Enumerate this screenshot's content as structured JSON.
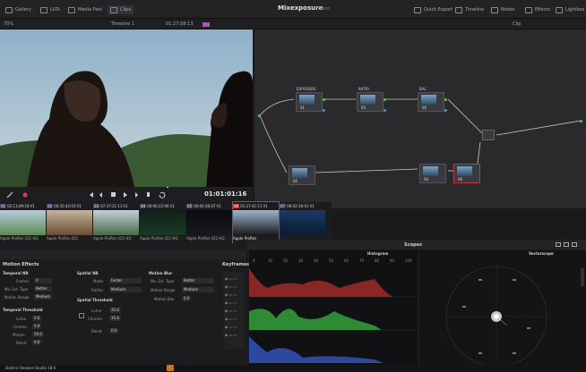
{
  "topbar": {
    "items": [
      "Gallery",
      "LUTs",
      "Media Pool",
      "Clips"
    ],
    "title": "Mixexposure",
    "status": "Edited",
    "right_items": [
      "Quick Export",
      "Timeline",
      "Nodes",
      "Effects",
      "Lightbox"
    ]
  },
  "subbar": {
    "zoom": "70%",
    "timeline": "Timeline 1",
    "timecode": "01:27:58:13",
    "mode": "Clip"
  },
  "viewer": {
    "timecode": "01:01:01:16"
  },
  "nodes": [
    {
      "label": "EXPOSURE",
      "num": "01"
    },
    {
      "label": "RATIO",
      "num": "03"
    },
    {
      "label": "BAL",
      "num": "05"
    },
    {
      "label": "",
      "num": "02"
    },
    {
      "label": "",
      "num": "04"
    },
    {
      "label": "",
      "num": "06"
    }
  ],
  "clips": [
    {
      "num": "01",
      "tc": "02:13:49:18",
      "track": "V1",
      "codec": "Apple ProRes 422 HQ"
    },
    {
      "num": "02",
      "tc": "00:35:42:03",
      "track": "V1",
      "codec": "Apple ProRes 422"
    },
    {
      "num": "03",
      "tc": "07:37:21:13",
      "track": "V1",
      "codec": "Apple ProRes 422 HQ"
    },
    {
      "num": "04",
      "tc": "00:00:22:06",
      "track": "V1",
      "codec": "Apple ProRes 422 HQ"
    },
    {
      "num": "05",
      "tc": "00:00:36:07",
      "track": "V1",
      "codec": "Apple ProRes 422 HQ"
    },
    {
      "num": "06",
      "tc": "01:27:41:11",
      "track": "V1",
      "codec": "Apple ProRes"
    },
    {
      "num": "07",
      "tc": "06:02:16:01",
      "track": "V1",
      "codec": ""
    }
  ],
  "motion_effects": {
    "title": "Motion Effects",
    "temporal_nr": "Temporal NR",
    "frames_label": "Frames",
    "frames_value": "0",
    "mo_est_label": "Mo. Est. Type",
    "mo_est_value": "Better",
    "motion_range_label": "Motion Range",
    "motion_range_value": "Medium",
    "temporal_threshold": "Temporal Threshold",
    "luma_label": "Luma",
    "luma_value": "0.0",
    "chroma_label": "Chroma",
    "chroma_value": "0.0",
    "motion_label": "Motion",
    "motion_value": "50.0",
    "blend_label": "Blend",
    "blend_value": "0.0"
  },
  "spatial_nr": {
    "title": "Spatial NR",
    "mode_label": "Mode",
    "mode_value": "Faster",
    "radius_label": "Radius",
    "radius_value": "Medium",
    "threshold_title": "Spatial Threshold",
    "luma_label": "Luma",
    "luma_value": "35.6",
    "chroma_label": "Chroma",
    "chroma_value": "35.6",
    "blend_label": "Blend",
    "blend_value": "0.0"
  },
  "motion_blur": {
    "title": "Motion Blur",
    "mo_est_label": "Mo. Est. Type",
    "mo_est_value": "Better",
    "motion_range_label": "Motion Range",
    "motion_range_value": "Medium",
    "blur_label": "Motion Blur",
    "blur_value": "0.0"
  },
  "keyframes": {
    "title": "Keyframes"
  },
  "scopes": {
    "title": "Scopes",
    "histogram": "Histogram",
    "vectorscope": "Vectorscope",
    "ticks": [
      "0",
      "10",
      "20",
      "30",
      "40",
      "50",
      "60",
      "70",
      "80",
      "90",
      "100"
    ]
  },
  "status": {
    "app": "DaVinci Resolve Studio 18.6"
  }
}
